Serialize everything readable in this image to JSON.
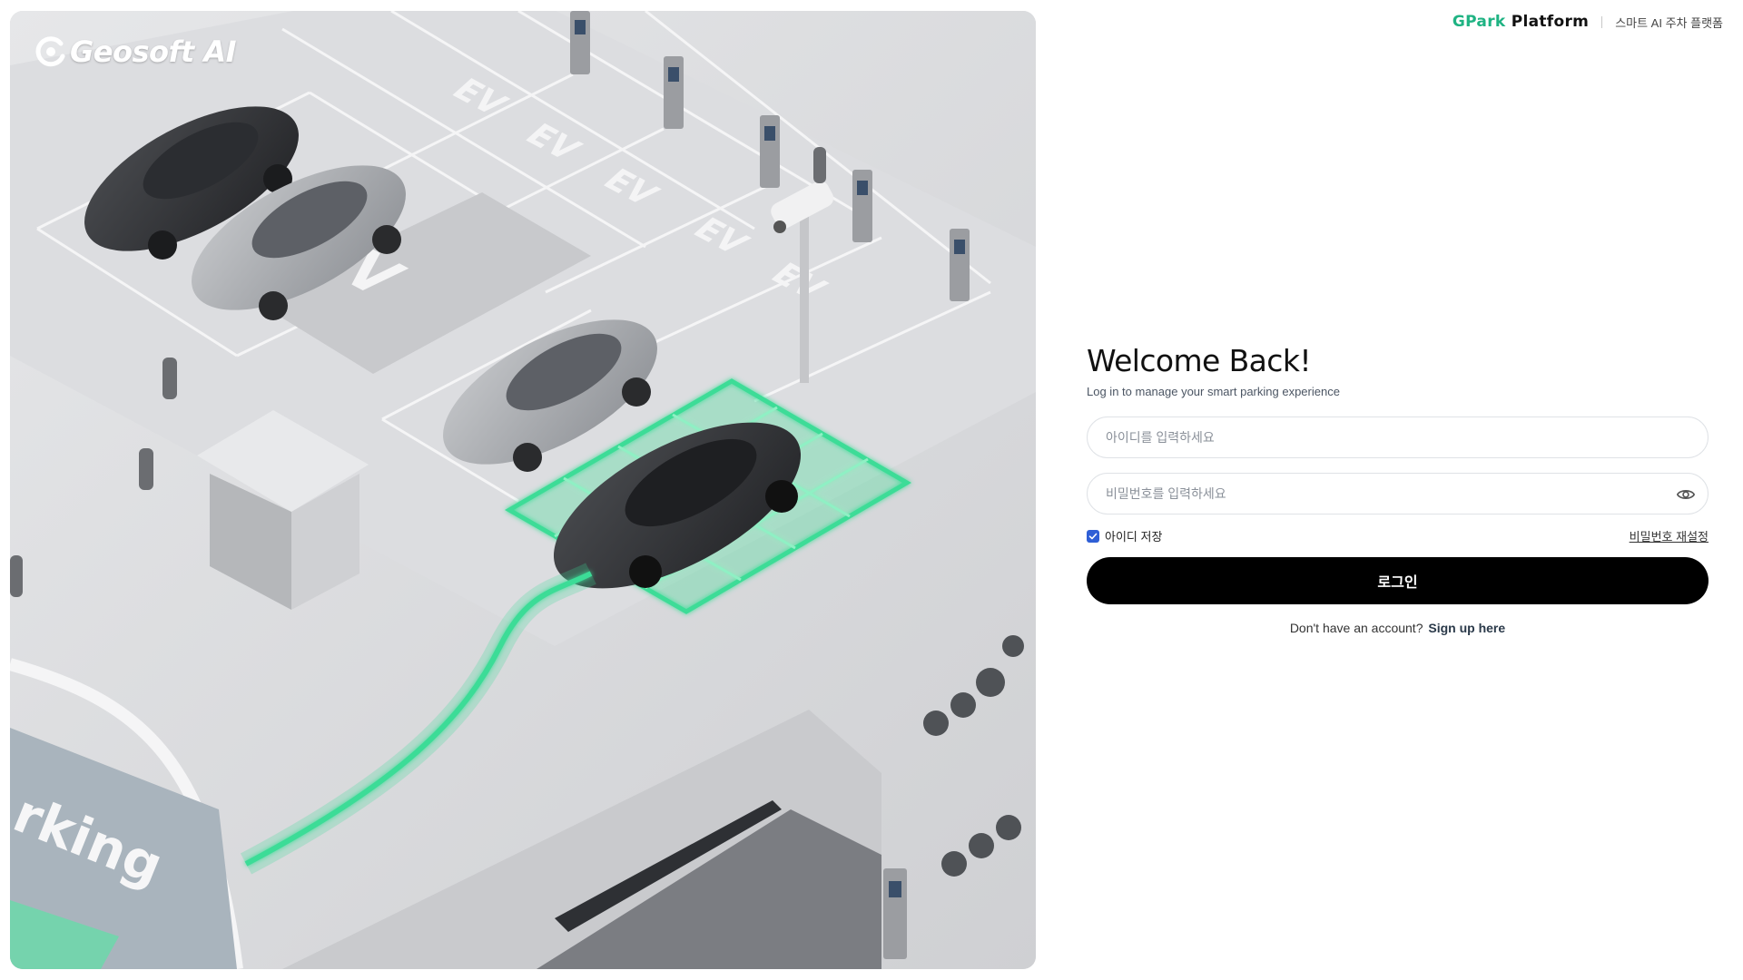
{
  "hero": {
    "logo_text": "Geosoft AI",
    "scene": {
      "ev_labels": [
        "EV",
        "EV",
        "EV",
        "EV",
        "EV",
        "EV",
        "EV"
      ],
      "sign_text": "rking",
      "highlight_color": "#3ddc97"
    }
  },
  "header": {
    "brand_accent": "GPark",
    "brand_rest": " Platform",
    "tagline": "스마트 AI 주차 플랫폼"
  },
  "login": {
    "title": "Welcome Back!",
    "subtitle": "Log in to manage your smart parking experience",
    "id_placeholder": "아이디를 입력하세요",
    "password_placeholder": "비밀번호를 입력하세요",
    "remember_label": "아이디 저장",
    "remember_checked": true,
    "reset_label": "비밀번호 재설정",
    "submit_label": "로그인",
    "signup_prompt": "Don't have an account?",
    "signup_link": "Sign up here"
  },
  "colors": {
    "accent": "#1fb383",
    "button": "#000000",
    "checkbox": "#2f5fd6"
  },
  "icons": {
    "password_toggle": "eye-icon",
    "checkbox_mark": "check-icon",
    "logo_mark": "geosoft-logo-icon"
  }
}
